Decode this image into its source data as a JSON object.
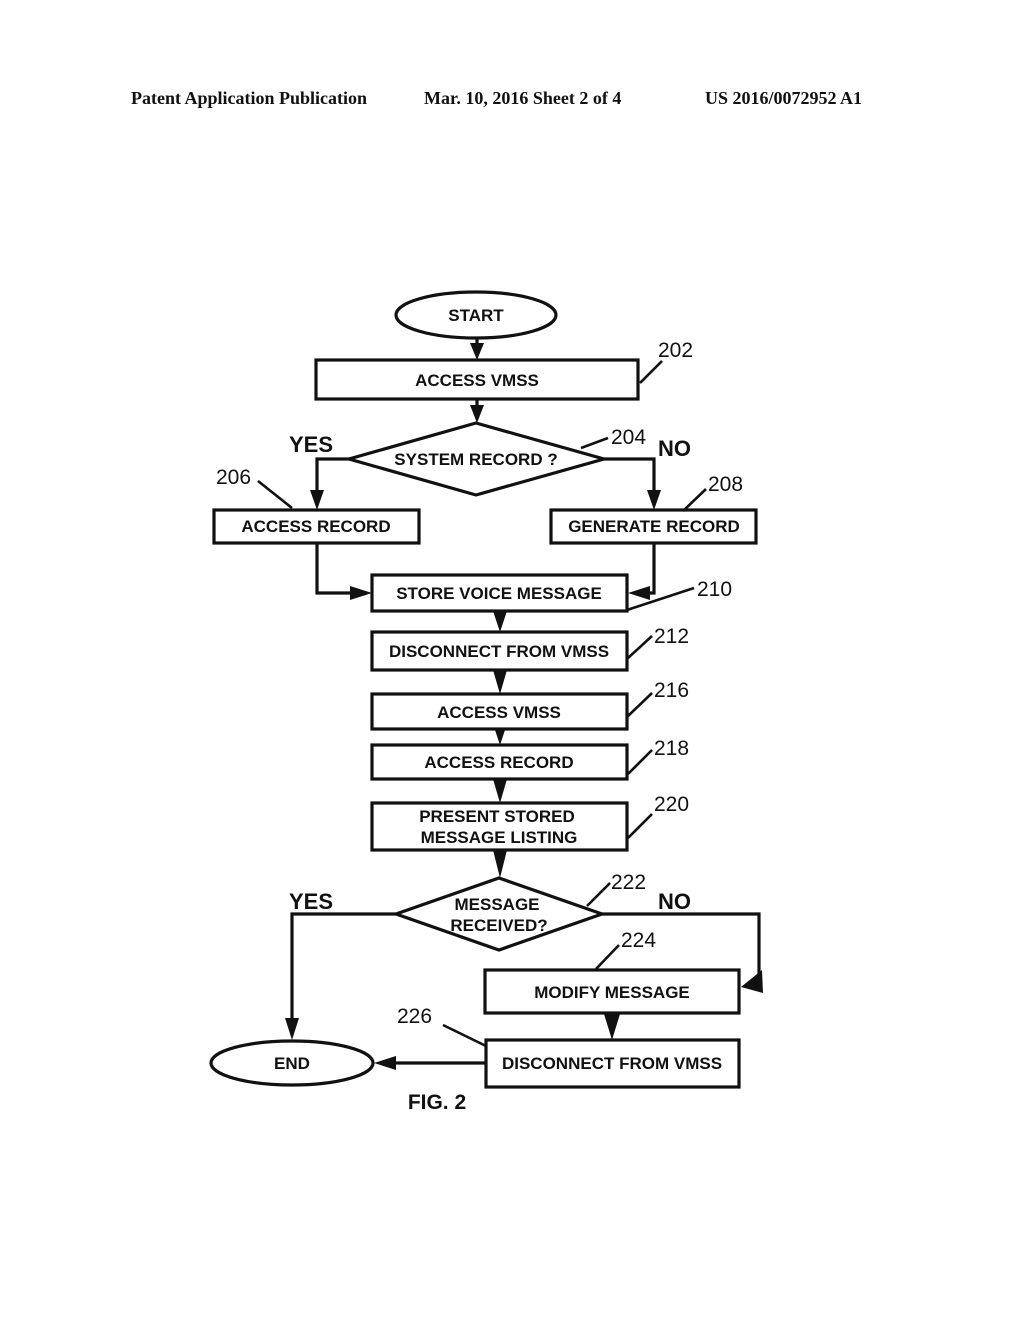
{
  "header": {
    "publication": "Patent Application Publication",
    "date_sheet": "Mar. 10, 2016  Sheet 2 of 4",
    "number": "US 2016/0072952 A1"
  },
  "figure": {
    "label": "FIG. 2",
    "nodes": {
      "start": {
        "label": "START",
        "shape": "terminal"
      },
      "n202": {
        "ref": "202",
        "label": "ACCESS VMSS",
        "shape": "process"
      },
      "n204": {
        "ref": "204",
        "label": "SYSTEM RECORD ?",
        "shape": "decision"
      },
      "n206": {
        "ref": "206",
        "label": "ACCESS RECORD",
        "shape": "process"
      },
      "n208": {
        "ref": "208",
        "label": "GENERATE RECORD",
        "shape": "process"
      },
      "n210": {
        "ref": "210",
        "label": "STORE VOICE MESSAGE",
        "shape": "process"
      },
      "n212": {
        "ref": "212",
        "label": "DISCONNECT FROM VMSS",
        "shape": "process"
      },
      "n216": {
        "ref": "216",
        "label": "ACCESS VMSS",
        "shape": "process"
      },
      "n218": {
        "ref": "218",
        "label": "ACCESS RECORD",
        "shape": "process"
      },
      "n220": {
        "ref": "220",
        "label_line1": "PRESENT STORED",
        "label_line2": "MESSAGE LISTING",
        "shape": "process"
      },
      "n222": {
        "ref": "222",
        "label_line1": "MESSAGE",
        "label_line2": "RECEIVED?",
        "shape": "decision"
      },
      "n224": {
        "ref": "224",
        "label": "MODIFY MESSAGE",
        "shape": "process"
      },
      "n226": {
        "ref": "226",
        "label": "DISCONNECT FROM VMSS",
        "shape": "process"
      },
      "end": {
        "label": "END",
        "shape": "terminal"
      }
    },
    "branches": {
      "n204_yes": "YES",
      "n204_no": "NO",
      "n222_yes": "YES",
      "n222_no": "NO"
    },
    "edges": [
      [
        "start",
        "n202"
      ],
      [
        "n202",
        "n204"
      ],
      [
        "n204",
        "n206",
        "YES"
      ],
      [
        "n204",
        "n208",
        "NO"
      ],
      [
        "n206",
        "n210"
      ],
      [
        "n208",
        "n210"
      ],
      [
        "n210",
        "n212"
      ],
      [
        "n212",
        "n216"
      ],
      [
        "n216",
        "n218"
      ],
      [
        "n218",
        "n220"
      ],
      [
        "n220",
        "n222"
      ],
      [
        "n222",
        "end",
        "YES"
      ],
      [
        "n222",
        "n224",
        "NO"
      ],
      [
        "n224",
        "n226"
      ],
      [
        "n226",
        "end"
      ]
    ]
  }
}
